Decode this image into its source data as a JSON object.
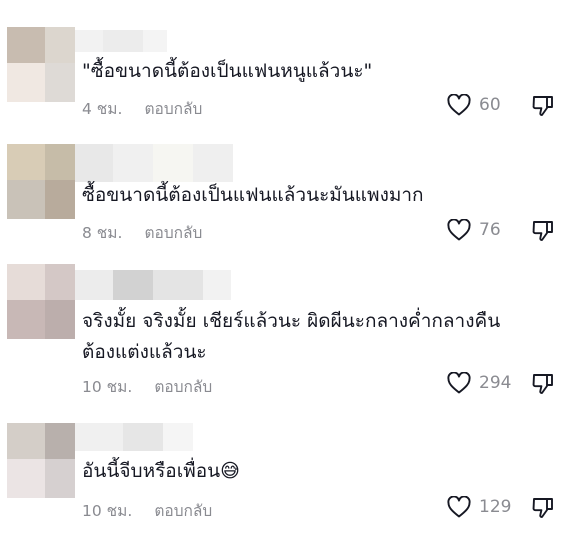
{
  "comments": [
    {
      "text_lines": [
        "\"ซื้อขนาดนี้ต้องเป็นแฟนหนูแล้วนะ\""
      ],
      "time": "4 ชม.",
      "reply_label": "ตอบกลับ",
      "likes": "60",
      "avatar_colors": [
        "#c8bcb0",
        "#dcd6ce",
        "#f0e8e2",
        "#dedad6"
      ],
      "username_colors": [
        "#f2f2f2",
        "#ececec",
        "#f4f4f4"
      ]
    },
    {
      "text_lines": [
        "ซื้อขนาดนี้ต้องเป็นแฟนแล้วนะมันแพงมาก"
      ],
      "time": "8 ชม.",
      "reply_label": "ตอบกลับ",
      "likes": "76",
      "avatar_colors": [
        "#d8ccb6",
        "#c6bca8",
        "#c9c2b8",
        "#b8ab9c"
      ],
      "username_colors": [
        "#e8e8e8",
        "#f0f0f0",
        "#f6f6f2",
        "#efefef"
      ]
    },
    {
      "text_lines": [
        "จริงมั้ย จริงมั้ย เชียร์แล้วนะ ผิดผีนะกลางค่ำกลางคืน",
        "ต้องแต่งแล้วนะ"
      ],
      "time": "10 ชม.",
      "reply_label": "ตอบกลับ",
      "likes": "294",
      "avatar_colors": [
        "#e6dcd8",
        "#d4c8c6",
        "#c8b8b6",
        "#bcaeac"
      ],
      "username_colors": [
        "#ececec",
        "#d2d2d2",
        "#e4e4e4",
        "#f2f2f2"
      ]
    },
    {
      "text_lines": [
        "อันนี้จีบหรือเพื่อน😅"
      ],
      "time": "10 ชม.",
      "reply_label": "ตอบกลับ",
      "likes": "129",
      "avatar_colors": [
        "#d4cec8",
        "#b8b0ac",
        "#ebe4e4",
        "#d6d0d0"
      ],
      "username_colors": [
        "#f0f0f0",
        "#e6e6e6",
        "#f5f5f5"
      ]
    }
  ],
  "icons": {
    "like": "heart-outline-icon",
    "dislike": "thumbs-down-outline-icon"
  },
  "colors": {
    "text": "#161823",
    "secondary": "#8a8b91"
  }
}
